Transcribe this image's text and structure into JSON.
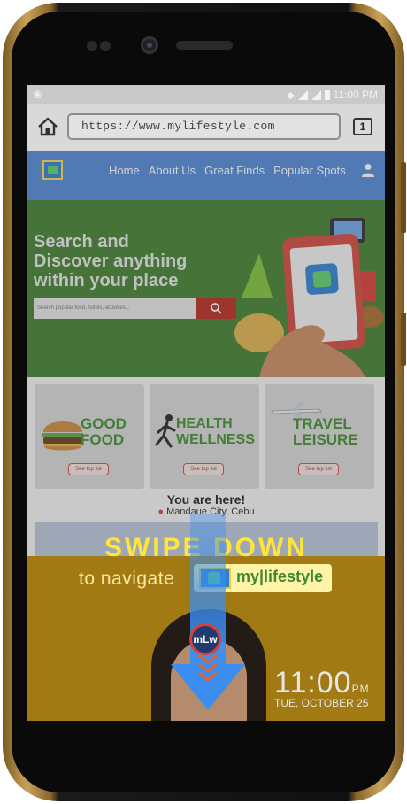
{
  "status_bar": {
    "time": "11:00 PM"
  },
  "browser": {
    "url": "https://www.mylifestyle.com",
    "tab_count": "1"
  },
  "nav": {
    "links": [
      "Home",
      "About Us",
      "Great Finds",
      "Popular Spots"
    ]
  },
  "hero": {
    "title_lines": [
      "Search and",
      "Discover anything",
      "within your place"
    ],
    "search_placeholder": "Search popular food, hotels, activities..."
  },
  "cards": [
    {
      "title_lines": [
        "GOOD",
        "FOOD"
      ],
      "button": "See top list"
    },
    {
      "title_lines": [
        "HEALTH",
        "WELLNESS"
      ],
      "button": "See top list"
    },
    {
      "title_lines": [
        "TRAVEL",
        "LEISURE"
      ],
      "button": "See top list"
    }
  ],
  "location": {
    "title": "You are here!",
    "place": "Mandaue City, Cebu"
  },
  "promo": {
    "headline": "SWIPE DOWN",
    "subline": "to navigate",
    "brand": "my|lifestyle",
    "badge": "mLw"
  },
  "lockscreen": {
    "time": "11:00",
    "ampm": "PM",
    "date": "TUE, OCTOBER 25"
  },
  "colors": {
    "accent_green": "#3e8a2c",
    "headline_yellow": "#ffe43a",
    "arrow_blue": "#3b8ef0",
    "search_red": "#b8281e"
  }
}
